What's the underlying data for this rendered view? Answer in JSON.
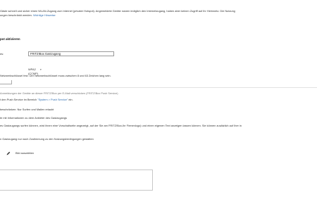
{
  "intro": {
    "line1": "Gäste schnell und sicher einen WLAN-Zugang zum Internet (privater Hotspot). Angemeldete Geräte nutzen lediglich den Internetzugang, haben aber keinen Zugriff auf Ihr Heimnetz. Die Nutzung",
    "line2_text": "ungen beschränkt werden. ",
    "line2_link": "Wichtige Hinweise"
  },
  "activate_label": "pot aktivieren",
  "ssid": {
    "label": "es:",
    "value": "FRITZ!Box Gastzugang"
  },
  "security": {
    "selected": "WPA2 (CCMP)",
    "arrow": "▾"
  },
  "key_hint": "Netzwerkschlüssel fest. Der Netzwerkschlüssel muss zwischen 8 und 63 Zeichen lang sein.",
  "notify": {
    "label": "Anmeldungen der Geräte an dieser FRITZ!Box per E-Mail verschicken (FRITZ!Box Push Service)",
    "setup_prefix": "t den Push Service im Bereich ",
    "setup_link": "\"System > Push Service\"",
    "setup_suffix": " ein."
  },
  "options": {
    "surf_mail": "beschränken: Nur Surfen und Mailen erlaubt",
    "info_page": "te mit Informationen zu dem Anbieter des Gastzugangs",
    "info_page_desc": "es Gastzugangs surfen können, wird ihnen eine Vorschaltseite angezeigt, auf der Sie am FRITZ!Box-Ihr Firmenlogo) und einen eigenen Text anzeigen lassen können. Sie können zusätzlich auf Ihre in",
    "terms": "n Gastzugang nur nach Zustimmung zu den Nutzungsbedingungen gestatten"
  },
  "image_button_label": "Bild auswählen",
  "icons": {
    "edit": "pencil-icon"
  }
}
